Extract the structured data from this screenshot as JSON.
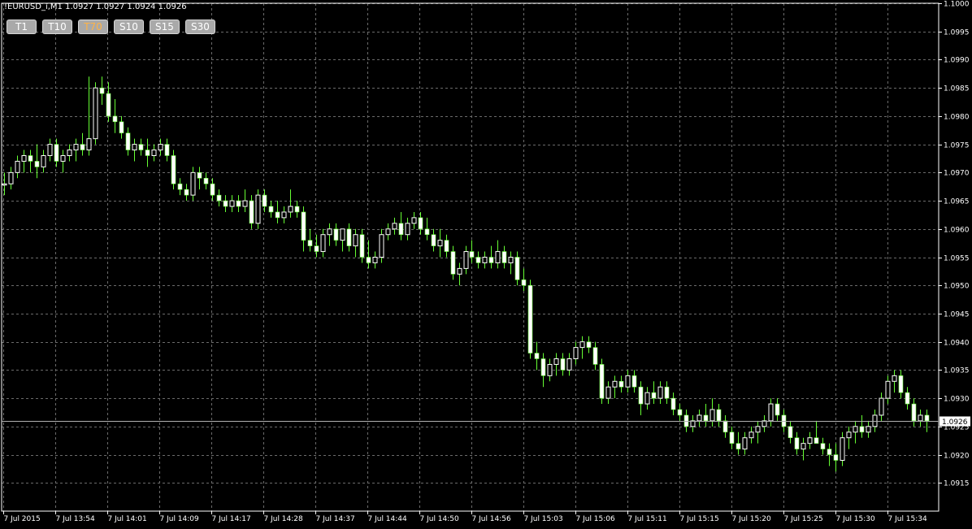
{
  "header": {
    "symbol_text": "!EURUSD_i,M1  1.0927 1.0927 1.0924 1.0926"
  },
  "buttons": [
    {
      "label": "T1",
      "active": false
    },
    {
      "label": "T10",
      "active": false
    },
    {
      "label": "T70",
      "active": true
    },
    {
      "label": "S10",
      "active": false
    },
    {
      "label": "S15",
      "active": false
    },
    {
      "label": "S30",
      "active": false
    }
  ],
  "colors": {
    "background": "#000000",
    "grid": "#6b6b6b",
    "bull": "#ffffff",
    "bear": "#ffffff",
    "wick": "#66ff33",
    "axis": "#ffffff",
    "current_price_bg": "#ffffff",
    "current_price_text": "#000000"
  },
  "chart_data": {
    "type": "candlestick",
    "title": "",
    "symbol": "!EURUSD_i",
    "timeframe": "M1",
    "ylim": [
      1.091,
      1.1
    ],
    "y_ticks": [
      "1.1000",
      "1.0995",
      "1.0990",
      "1.0985",
      "1.0980",
      "1.0975",
      "1.0970",
      "1.0965",
      "1.0960",
      "1.0955",
      "1.0950",
      "1.0945",
      "1.0940",
      "1.0935",
      "1.0930",
      "1.0925",
      "1.0920",
      "1.0915"
    ],
    "x_ticks": [
      "7 Jul 2015",
      "7 Jul 13:54",
      "7 Jul 14:01",
      "7 Jul 14:09",
      "7 Jul 14:17",
      "7 Jul 14:28",
      "7 Jul 14:37",
      "7 Jul 14:44",
      "7 Jul 14:50",
      "7 Jul 14:56",
      "7 Jul 15:03",
      "7 Jul 15:06",
      "7 Jul 15:11",
      "7 Jul 15:15",
      "7 Jul 15:20",
      "7 Jul 15:25",
      "7 Jul 15:30",
      "7 Jul 15:34"
    ],
    "current_price": "1.0926",
    "grid": true,
    "candles": [
      [
        1.0968,
        1.097,
        1.0966,
        1.0968
      ],
      [
        1.0968,
        1.0971,
        1.0967,
        1.097
      ],
      [
        1.097,
        1.0973,
        1.0969,
        1.0972
      ],
      [
        1.0972,
        1.0974,
        1.097,
        1.0973
      ],
      [
        1.0973,
        1.0974,
        1.097,
        1.0972
      ],
      [
        1.0972,
        1.0975,
        1.0969,
        1.0971
      ],
      [
        1.0971,
        1.0974,
        1.097,
        1.0973
      ],
      [
        1.0973,
        1.0976,
        1.0972,
        1.0975
      ],
      [
        1.0975,
        1.0976,
        1.0971,
        1.0972
      ],
      [
        1.0972,
        1.0974,
        1.097,
        1.0973
      ],
      [
        1.0973,
        1.0975,
        1.0972,
        1.0974
      ],
      [
        1.0974,
        1.0976,
        1.0972,
        1.0975
      ],
      [
        1.0975,
        1.0977,
        1.0973,
        1.0974
      ],
      [
        1.0974,
        1.0987,
        1.0973,
        1.0976
      ],
      [
        1.0976,
        1.0986,
        1.0975,
        1.0985
      ],
      [
        1.0985,
        1.0987,
        1.0982,
        1.0984
      ],
      [
        1.0984,
        1.0986,
        1.0979,
        1.098
      ],
      [
        1.098,
        1.0983,
        1.0977,
        1.0979
      ],
      [
        1.0979,
        1.098,
        1.0976,
        1.0977
      ],
      [
        1.0977,
        1.0978,
        1.0973,
        1.0974
      ],
      [
        1.0974,
        1.0976,
        1.0972,
        1.0975
      ],
      [
        1.0975,
        1.0976,
        1.0973,
        1.0974
      ],
      [
        1.0974,
        1.0976,
        1.0971,
        1.0973
      ],
      [
        1.0973,
        1.0975,
        1.0972,
        1.0974
      ],
      [
        1.0974,
        1.0976,
        1.0973,
        1.0975
      ],
      [
        1.0975,
        1.0976,
        1.0972,
        1.0973
      ],
      [
        1.0973,
        1.0974,
        1.0967,
        1.0968
      ],
      [
        1.0968,
        1.0969,
        1.0966,
        1.0967
      ],
      [
        1.0967,
        1.0968,
        1.0965,
        1.0966
      ],
      [
        1.0966,
        1.0971,
        1.0965,
        1.097
      ],
      [
        1.097,
        1.0971,
        1.0967,
        1.0969
      ],
      [
        1.0969,
        1.097,
        1.0967,
        1.0968
      ],
      [
        1.0968,
        1.0969,
        1.0965,
        1.0966
      ],
      [
        1.0966,
        1.0967,
        1.0964,
        1.0965
      ],
      [
        1.0965,
        1.0966,
        1.0963,
        1.0964
      ],
      [
        1.0964,
        1.0966,
        1.0963,
        1.0965
      ],
      [
        1.0965,
        1.0966,
        1.0963,
        1.0964
      ],
      [
        1.0964,
        1.0967,
        1.0963,
        1.0965
      ],
      [
        1.0965,
        1.0966,
        1.096,
        1.0961
      ],
      [
        1.0961,
        1.0967,
        1.096,
        1.0966
      ],
      [
        1.0966,
        1.0967,
        1.0963,
        1.0964
      ],
      [
        1.0964,
        1.0965,
        1.0962,
        1.0963
      ],
      [
        1.0963,
        1.0965,
        1.0961,
        1.0962
      ],
      [
        1.0962,
        1.0964,
        1.0961,
        1.0963
      ],
      [
        1.0963,
        1.0967,
        1.0962,
        1.0964
      ],
      [
        1.0964,
        1.0965,
        1.0962,
        1.0963
      ],
      [
        1.0963,
        1.0964,
        1.0956,
        1.0958
      ],
      [
        1.0958,
        1.096,
        1.0956,
        1.0957
      ],
      [
        1.0957,
        1.0959,
        1.0955,
        1.0956
      ],
      [
        1.0956,
        1.096,
        1.0955,
        1.0959
      ],
      [
        1.0959,
        1.0961,
        1.0957,
        1.096
      ],
      [
        1.096,
        1.0961,
        1.0957,
        1.0958
      ],
      [
        1.0958,
        1.096,
        1.0956,
        1.096
      ],
      [
        1.096,
        1.0961,
        1.0956,
        1.0957
      ],
      [
        1.0957,
        1.096,
        1.0955,
        1.0959
      ],
      [
        1.0959,
        1.096,
        1.0954,
        1.0955
      ],
      [
        1.0955,
        1.0958,
        1.0953,
        1.0954
      ],
      [
        1.0954,
        1.0956,
        1.0953,
        1.0955
      ],
      [
        1.0955,
        1.096,
        1.0954,
        1.0959
      ],
      [
        1.0959,
        1.0961,
        1.0958,
        1.096
      ],
      [
        1.096,
        1.0962,
        1.0959,
        1.0961
      ],
      [
        1.0961,
        1.0963,
        1.0958,
        1.0959
      ],
      [
        1.0959,
        1.0962,
        1.0958,
        1.0961
      ],
      [
        1.0961,
        1.0963,
        1.096,
        1.0962
      ],
      [
        1.0962,
        1.0963,
        1.0959,
        1.096
      ],
      [
        1.096,
        1.0962,
        1.0958,
        1.0959
      ],
      [
        1.0959,
        1.096,
        1.0956,
        1.0957
      ],
      [
        1.0957,
        1.096,
        1.0955,
        1.0958
      ],
      [
        1.0958,
        1.0959,
        1.0955,
        1.0956
      ],
      [
        1.0956,
        1.0957,
        1.0951,
        1.0952
      ],
      [
        1.0952,
        1.0954,
        1.095,
        1.0953
      ],
      [
        1.0953,
        1.0957,
        1.0952,
        1.0956
      ],
      [
        1.0956,
        1.0958,
        1.0954,
        1.0955
      ],
      [
        1.0955,
        1.0956,
        1.0953,
        1.0954
      ],
      [
        1.0954,
        1.0956,
        1.0953,
        1.0955
      ],
      [
        1.0955,
        1.0957,
        1.0953,
        1.0954
      ],
      [
        1.0954,
        1.0958,
        1.0953,
        1.0956
      ],
      [
        1.0956,
        1.0957,
        1.0953,
        1.0954
      ],
      [
        1.0954,
        1.0956,
        1.0952,
        1.0955
      ],
      [
        1.0955,
        1.0956,
        1.095,
        1.0951
      ],
      [
        1.0951,
        1.0953,
        1.0949,
        1.095
      ],
      [
        1.095,
        1.0951,
        1.0937,
        1.0938
      ],
      [
        1.0938,
        1.094,
        1.0935,
        1.0937
      ],
      [
        1.0937,
        1.0938,
        1.0932,
        1.0934
      ],
      [
        1.0934,
        1.0937,
        1.0933,
        1.0936
      ],
      [
        1.0936,
        1.0938,
        1.0934,
        1.0937
      ],
      [
        1.0937,
        1.0938,
        1.0934,
        1.0935
      ],
      [
        1.0935,
        1.0938,
        1.0934,
        1.0937
      ],
      [
        1.0937,
        1.094,
        1.0936,
        1.0939
      ],
      [
        1.0939,
        1.0941,
        1.0937,
        1.094
      ],
      [
        1.094,
        1.0941,
        1.0938,
        1.0939
      ],
      [
        1.0939,
        1.094,
        1.0935,
        1.0936
      ],
      [
        1.0936,
        1.0937,
        1.0929,
        1.093
      ],
      [
        1.093,
        1.0933,
        1.0929,
        1.0932
      ],
      [
        1.0932,
        1.0934,
        1.093,
        1.0933
      ],
      [
        1.0933,
        1.0934,
        1.0931,
        1.0932
      ],
      [
        1.0932,
        1.0935,
        1.0931,
        1.0934
      ],
      [
        1.0934,
        1.0935,
        1.0931,
        1.0932
      ],
      [
        1.0932,
        1.0933,
        1.0927,
        1.0929
      ],
      [
        1.0929,
        1.0932,
        1.0928,
        1.0931
      ],
      [
        1.0931,
        1.0933,
        1.0929,
        1.093
      ],
      [
        1.093,
        1.0933,
        1.0929,
        1.0932
      ],
      [
        1.0932,
        1.0933,
        1.0929,
        1.093
      ],
      [
        1.093,
        1.0931,
        1.0927,
        1.0928
      ],
      [
        1.0928,
        1.0929,
        1.0926,
        1.0927
      ],
      [
        1.0927,
        1.0928,
        1.0924,
        1.0925
      ],
      [
        1.0925,
        1.0927,
        1.0924,
        1.0926
      ],
      [
        1.0926,
        1.0928,
        1.0925,
        1.0927
      ],
      [
        1.0927,
        1.0929,
        1.0925,
        1.0926
      ],
      [
        1.0926,
        1.093,
        1.0925,
        1.0928
      ],
      [
        1.0928,
        1.0929,
        1.0925,
        1.0926
      ],
      [
        1.0926,
        1.0927,
        1.0923,
        1.0924
      ],
      [
        1.0924,
        1.0925,
        1.0921,
        1.0922
      ],
      [
        1.0922,
        1.0924,
        1.092,
        1.0921
      ],
      [
        1.0921,
        1.0924,
        1.092,
        1.0923
      ],
      [
        1.0923,
        1.0925,
        1.0922,
        1.0924
      ],
      [
        1.0924,
        1.0926,
        1.0922,
        1.0925
      ],
      [
        1.0925,
        1.0927,
        1.0924,
        1.0926
      ],
      [
        1.0926,
        1.093,
        1.0925,
        1.0929
      ],
      [
        1.0929,
        1.093,
        1.0926,
        1.0927
      ],
      [
        1.0927,
        1.0928,
        1.0924,
        1.0925
      ],
      [
        1.0925,
        1.0926,
        1.0922,
        1.0923
      ],
      [
        1.0923,
        1.0924,
        1.092,
        1.0921
      ],
      [
        1.0921,
        1.0923,
        1.0919,
        1.0922
      ],
      [
        1.0922,
        1.0924,
        1.0921,
        1.0923
      ],
      [
        1.0923,
        1.0926,
        1.0922,
        1.0922
      ],
      [
        1.0922,
        1.0923,
        1.092,
        1.0921
      ],
      [
        1.0921,
        1.0922,
        1.0918,
        1.092
      ],
      [
        1.092,
        1.0922,
        1.0917,
        1.0919
      ],
      [
        1.0919,
        1.0924,
        1.0918,
        1.0923
      ],
      [
        1.0923,
        1.0925,
        1.0921,
        1.0924
      ],
      [
        1.0924,
        1.0926,
        1.0922,
        1.0925
      ],
      [
        1.0925,
        1.0927,
        1.0923,
        1.0924
      ],
      [
        1.0924,
        1.0926,
        1.0923,
        1.0925
      ],
      [
        1.0925,
        1.0928,
        1.0924,
        1.0927
      ],
      [
        1.0927,
        1.0931,
        1.0926,
        1.093
      ],
      [
        1.093,
        1.0934,
        1.0929,
        1.0933
      ],
      [
        1.0933,
        1.0935,
        1.0931,
        1.0934
      ],
      [
        1.0934,
        1.0935,
        1.093,
        1.0931
      ],
      [
        1.0931,
        1.0932,
        1.0928,
        1.0929
      ],
      [
        1.0929,
        1.093,
        1.0925,
        1.0926
      ],
      [
        1.0926,
        1.0928,
        1.0925,
        1.0927
      ],
      [
        1.0927,
        1.0928,
        1.0924,
        1.0926
      ]
    ]
  }
}
